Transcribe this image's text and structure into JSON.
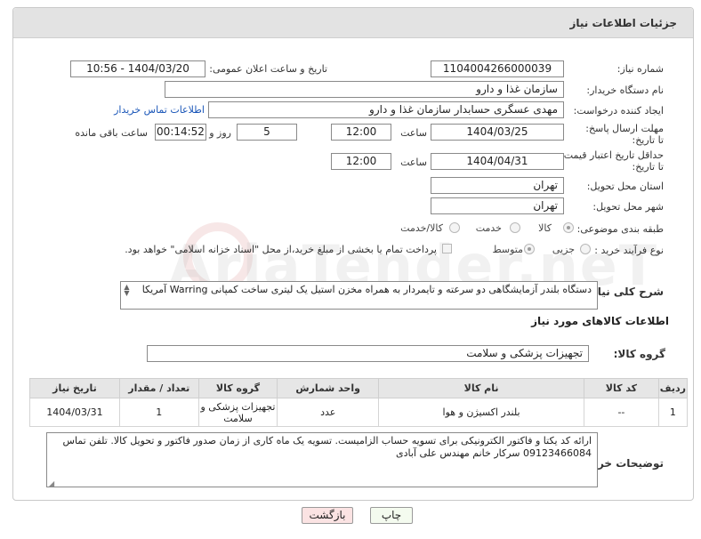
{
  "header": {
    "title": "جزئیات اطلاعات نیاز"
  },
  "fields": {
    "need_number_label": "شماره نیاز:",
    "need_number": "1104004266000039",
    "announce_label": "تاریخ و ساعت اعلان عمومی:",
    "announce_value": "1404/03/20 - 10:56",
    "buyer_org_label": "نام دستگاه خریدار:",
    "buyer_org": "سازمان غذا و دارو",
    "requester_label": "ایجاد کننده درخواست:",
    "requester": "مهدی عسگری حسابدار سازمان غذا و دارو",
    "buyer_contact_link": "اطلاعات تماس خریدار",
    "deadline_label": "مهلت ارسال پاسخ: تا تاریخ:",
    "deadline_date": "1404/03/25",
    "time_label": "ساعت",
    "deadline_time": "12:00",
    "days_value": "5",
    "days_label": "روز و",
    "remaining_time": "00:14:52",
    "remaining_label": "ساعت باقی مانده",
    "price_validity_label": "حداقل تاریخ اعتبار قیمت: تا تاریخ:",
    "price_validity_date": "1404/04/31",
    "time_label_2": "ساعت",
    "price_validity_time": "12:00",
    "province_label": "استان محل تحویل:",
    "province": "تهران",
    "city_label": "شهر محل تحویل:",
    "city": "تهران",
    "category_label": "طبقه بندی موضوعی:",
    "category_options": [
      "کالا",
      "خدمت",
      "کالا/خدمت"
    ],
    "process_label": "نوع فرآیند خرید :",
    "process_options": [
      "جزیی",
      "متوسط"
    ],
    "payment_note": "پرداخت تمام یا بخشی از مبلغ خرید،از محل \"اسناد خزانه اسلامی\" خواهد بود."
  },
  "description": {
    "label": "شرح کلی نیاز:",
    "text": "دستگاه بلندر آزمایشگاهی دو سرعته و تایمردار به همراه مخزن استیل یک لیتری ساخت کمپانی Warring آمریکا"
  },
  "goods_section": {
    "title": "اطلاعات کالاهای مورد نیاز",
    "group_label": "گروه کالا:",
    "group_value": "تجهیزات پزشکی و سلامت"
  },
  "table": {
    "headers": [
      "ردیف",
      "کد کالا",
      "نام کالا",
      "واحد شمارش",
      "گروه کالا",
      "تعداد / مقدار",
      "تاریخ نیاز"
    ],
    "rows": [
      [
        "1",
        "--",
        "بلندر اکسیژن و هوا",
        "عدد",
        "تجهیزات پزشکی و سلامت",
        "1",
        "1404/03/31"
      ]
    ]
  },
  "buyer_notes": {
    "label": "توضیحات خریدار:",
    "text": "ارائه کد یکتا و فاکتور الکترونیکی برای تسویه حساب الزامیست. تسویه یک ماه کاری از زمان صدور فاکتور و تحویل کالا. تلفن تماس 09123466084 سرکار خانم مهندس علی آبادی"
  },
  "buttons": {
    "print": "چاپ",
    "back": "بازگشت"
  },
  "colors": {
    "link": "#1a56b8",
    "back_button": "#fbe3e3",
    "print_button": "#f4fbef"
  }
}
